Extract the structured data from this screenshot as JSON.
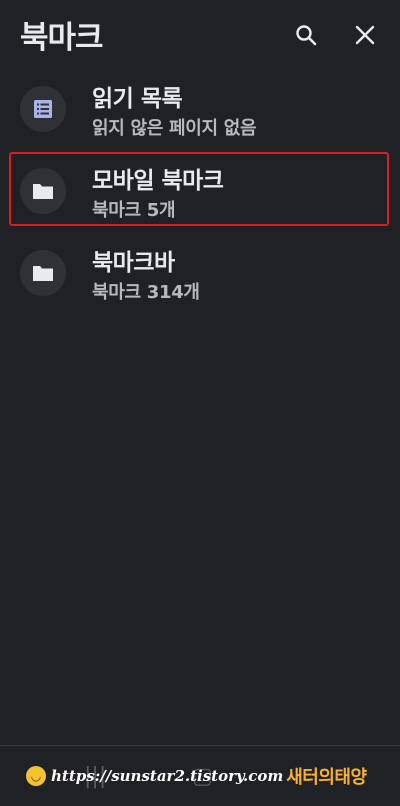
{
  "header": {
    "title": "북마크",
    "icons": {
      "search": "search-icon",
      "close": "close-icon"
    }
  },
  "items": [
    {
      "name": "읽기 목록",
      "sub": "읽지 않은 페이지 없음",
      "icon": "reading-list-icon"
    },
    {
      "name": "모바일 북마크",
      "sub": "북마크 5개",
      "icon": "folder-icon",
      "highlighted": true
    },
    {
      "name": "북마크바",
      "sub": "북마크 314개",
      "icon": "folder-icon"
    }
  ],
  "watermark": {
    "url": "https://sunstar2.tistory.com",
    "brand": "새터의태양"
  },
  "colors": {
    "background": "#202124",
    "icon_circle": "#303134",
    "highlight": "#d81e1e",
    "brand": "#f6b133"
  }
}
